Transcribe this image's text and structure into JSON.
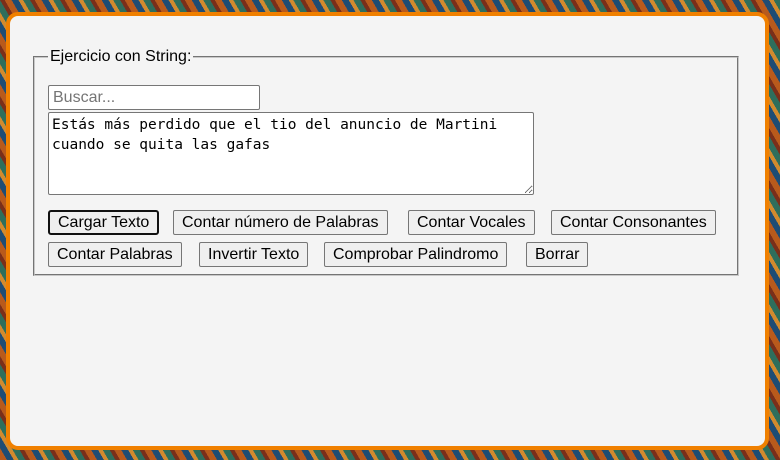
{
  "form": {
    "legend": "Ejercicio con String:",
    "search_placeholder": "Buscar...",
    "text_value": "Estás más perdido que el tio del anuncio de Martini cuando se quita las gafas"
  },
  "buttons": {
    "load_text": "Cargar Texto",
    "count_words_number": "Contar número de Palabras",
    "count_vowels": "Contar Vocales",
    "count_consonants": "Contar Consonantes",
    "count_words": "Contar Palabras",
    "reverse_text": "Invertir Texto",
    "check_palindrome": "Comprobar Palindromo",
    "clear": "Borrar"
  },
  "colors": {
    "frame_accent": "#f08000",
    "card_background": "#f4f4f4"
  }
}
